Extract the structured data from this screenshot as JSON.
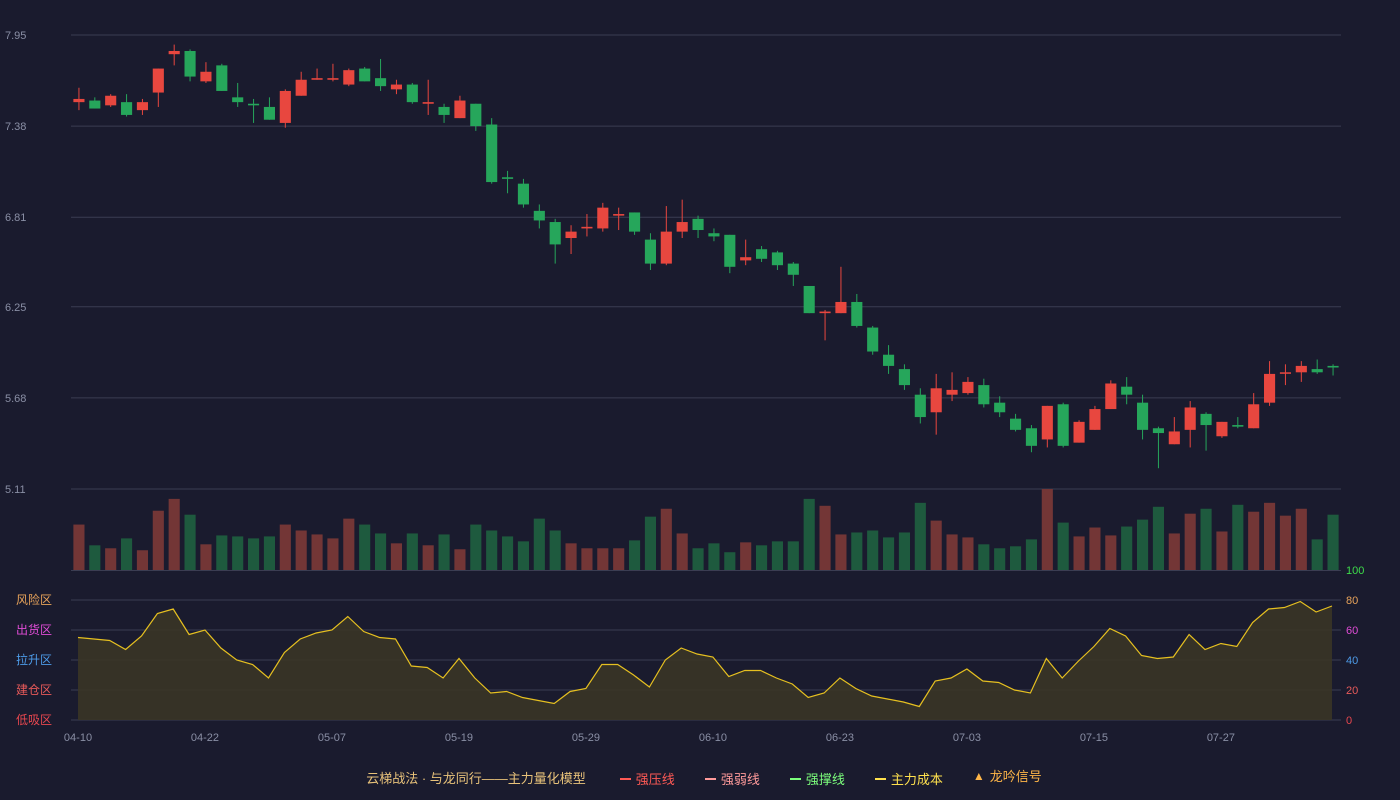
{
  "colors": {
    "up": "#e8473f",
    "down": "#26a65b",
    "vol_up": "#733636",
    "vol_down": "#1e5a3e",
    "grid": "#3b3d52",
    "axis_text": "#8a8fa5",
    "line": "#e6c020",
    "line_fill": "#3a3526"
  },
  "legend": {
    "title": "云梯战法 · 与龙同行——主力量化模型",
    "items": [
      {
        "label": "强压线",
        "color": "#ff5a55",
        "style": "solid",
        "icon": "solid-line-icon"
      },
      {
        "label": "强弱线",
        "color": "#ff9a9a",
        "style": "dashed",
        "icon": "dashed-line-icon"
      },
      {
        "label": "强撑线",
        "color": "#7cff7c",
        "style": "solid",
        "icon": "solid-line-icon"
      },
      {
        "label": "主力成本",
        "color": "#ffe14d",
        "style": "dashed",
        "icon": "dashed-line-icon"
      },
      {
        "label": "龙吟信号",
        "color": "#ffb648",
        "style": "triangle",
        "icon": "triangle-icon"
      }
    ]
  },
  "chart_data": [
    {
      "type": "candlestick",
      "y_ticks": [
        "7.95",
        "7.38",
        "6.81",
        "6.25",
        "5.68",
        "5.11"
      ],
      "ylim": [
        5.11,
        7.95
      ],
      "x_ticks": [
        {
          "i": 0,
          "label": "04-10"
        },
        {
          "i": 8,
          "label": "04-22"
        },
        {
          "i": 16,
          "label": "05-07"
        },
        {
          "i": 24,
          "label": "05-19"
        },
        {
          "i": 32,
          "label": "05-29"
        },
        {
          "i": 40,
          "label": "06-10"
        },
        {
          "i": 48,
          "label": "06-23"
        },
        {
          "i": 56,
          "label": "07-03"
        },
        {
          "i": 64,
          "label": "07-15"
        },
        {
          "i": 72,
          "label": "07-27"
        }
      ],
      "ohlc": [
        [
          7.53,
          7.55,
          7.48,
          7.62
        ],
        [
          7.54,
          7.49,
          7.49,
          7.56
        ],
        [
          7.51,
          7.57,
          7.5,
          7.58
        ],
        [
          7.53,
          7.45,
          7.44,
          7.58
        ],
        [
          7.48,
          7.53,
          7.45,
          7.55
        ],
        [
          7.59,
          7.74,
          7.5,
          7.74
        ],
        [
          7.83,
          7.85,
          7.76,
          7.89
        ],
        [
          7.85,
          7.69,
          7.66,
          7.86
        ],
        [
          7.66,
          7.72,
          7.65,
          7.78
        ],
        [
          7.76,
          7.6,
          7.6,
          7.77
        ],
        [
          7.56,
          7.53,
          7.5,
          7.65
        ],
        [
          7.52,
          7.51,
          7.4,
          7.55
        ],
        [
          7.5,
          7.42,
          7.42,
          7.56
        ],
        [
          7.4,
          7.6,
          7.37,
          7.61
        ],
        [
          7.57,
          7.67,
          7.57,
          7.72
        ],
        [
          7.67,
          7.68,
          7.67,
          7.74
        ],
        [
          7.67,
          7.68,
          7.66,
          7.77
        ],
        [
          7.64,
          7.73,
          7.63,
          7.74
        ],
        [
          7.74,
          7.66,
          7.66,
          7.75
        ],
        [
          7.68,
          7.63,
          7.6,
          7.8
        ],
        [
          7.61,
          7.64,
          7.58,
          7.67
        ],
        [
          7.64,
          7.53,
          7.52,
          7.65
        ],
        [
          7.52,
          7.53,
          7.45,
          7.67
        ],
        [
          7.5,
          7.45,
          7.4,
          7.52
        ],
        [
          7.43,
          7.54,
          7.43,
          7.57
        ],
        [
          7.52,
          7.38,
          7.35,
          7.52
        ],
        [
          7.39,
          7.03,
          7.02,
          7.43
        ],
        [
          7.06,
          7.05,
          6.96,
          7.1
        ],
        [
          7.02,
          6.89,
          6.87,
          7.05
        ],
        [
          6.85,
          6.79,
          6.74,
          6.89
        ],
        [
          6.78,
          6.64,
          6.52,
          6.8
        ],
        [
          6.68,
          6.72,
          6.58,
          6.76
        ],
        [
          6.74,
          6.75,
          6.69,
          6.83
        ],
        [
          6.74,
          6.87,
          6.72,
          6.9
        ],
        [
          6.82,
          6.83,
          6.73,
          6.87
        ],
        [
          6.84,
          6.72,
          6.7,
          6.84
        ],
        [
          6.67,
          6.52,
          6.48,
          6.71
        ],
        [
          6.52,
          6.72,
          6.51,
          6.88
        ],
        [
          6.72,
          6.78,
          6.68,
          6.92
        ],
        [
          6.8,
          6.73,
          6.68,
          6.82
        ],
        [
          6.71,
          6.69,
          6.66,
          6.74
        ],
        [
          6.7,
          6.5,
          6.46,
          6.7
        ],
        [
          6.54,
          6.56,
          6.51,
          6.67
        ],
        [
          6.61,
          6.55,
          6.53,
          6.63
        ],
        [
          6.59,
          6.51,
          6.48,
          6.6
        ],
        [
          6.52,
          6.45,
          6.38,
          6.53
        ],
        [
          6.38,
          6.21,
          6.21,
          6.38
        ],
        [
          6.21,
          6.22,
          6.04,
          6.23
        ],
        [
          6.21,
          6.28,
          6.21,
          6.5
        ],
        [
          6.28,
          6.13,
          6.12,
          6.33
        ],
        [
          6.12,
          5.97,
          5.95,
          6.13
        ],
        [
          5.95,
          5.88,
          5.83,
          6.01
        ],
        [
          5.86,
          5.76,
          5.73,
          5.89
        ],
        [
          5.7,
          5.56,
          5.52,
          5.74
        ],
        [
          5.59,
          5.74,
          5.45,
          5.83
        ],
        [
          5.7,
          5.73,
          5.66,
          5.84
        ],
        [
          5.71,
          5.78,
          5.7,
          5.81
        ],
        [
          5.76,
          5.64,
          5.62,
          5.8
        ],
        [
          5.65,
          5.59,
          5.56,
          5.69
        ],
        [
          5.55,
          5.48,
          5.47,
          5.58
        ],
        [
          5.49,
          5.38,
          5.34,
          5.51
        ],
        [
          5.42,
          5.63,
          5.37,
          5.63
        ],
        [
          5.64,
          5.38,
          5.37,
          5.65
        ],
        [
          5.4,
          5.53,
          5.4,
          5.54
        ],
        [
          5.48,
          5.61,
          5.48,
          5.63
        ],
        [
          5.61,
          5.77,
          5.61,
          5.79
        ],
        [
          5.75,
          5.7,
          5.64,
          5.81
        ],
        [
          5.65,
          5.48,
          5.42,
          5.7
        ],
        [
          5.49,
          5.46,
          5.24,
          5.5
        ],
        [
          5.39,
          5.47,
          5.39,
          5.56
        ],
        [
          5.48,
          5.62,
          5.37,
          5.66
        ],
        [
          5.58,
          5.51,
          5.35,
          5.59
        ],
        [
          5.44,
          5.53,
          5.43,
          5.53
        ],
        [
          5.51,
          5.5,
          5.49,
          5.56
        ],
        [
          5.49,
          5.64,
          5.49,
          5.71
        ],
        [
          5.65,
          5.83,
          5.63,
          5.91
        ],
        [
          5.84,
          5.84,
          5.76,
          5.89
        ],
        [
          5.84,
          5.88,
          5.78,
          5.91
        ],
        [
          5.86,
          5.84,
          5.83,
          5.92
        ],
        [
          5.88,
          5.87,
          5.82,
          5.89
        ]
      ]
    },
    {
      "type": "bar",
      "name": "volume",
      "values": [
        46,
        25,
        22,
        32,
        20,
        60,
        72,
        56,
        26,
        35,
        34,
        32,
        34,
        46,
        40,
        36,
        32,
        52,
        46,
        37,
        27,
        37,
        25,
        36,
        21,
        46,
        40,
        34,
        29,
        52,
        40,
        27,
        22,
        22,
        22,
        30,
        54,
        62,
        37,
        22,
        27,
        18,
        28,
        25,
        29,
        29,
        72,
        65,
        36,
        38,
        40,
        33,
        38,
        68,
        50,
        36,
        33,
        26,
        22,
        24,
        31,
        82,
        48,
        34,
        43,
        35,
        44,
        51,
        64,
        37,
        57,
        62,
        39,
        66,
        59,
        68,
        55,
        62,
        31,
        56
      ]
    },
    {
      "type": "area",
      "name": "indicator",
      "ylim": [
        0,
        100
      ],
      "y_ticks": [
        "100",
        "80",
        "60",
        "40",
        "20",
        "0"
      ],
      "zones": [
        "风险区",
        "出货区",
        "拉升区",
        "建仓区",
        "低吸区"
      ],
      "zone_colors": [
        "#e8a35a",
        "#e04cd6",
        "#4d9be8",
        "#e85a5a",
        "#e8474f"
      ],
      "tick_colors": [
        "#3ddc4a",
        "#e8a35a",
        "#e04cd6",
        "#4d9be8",
        "#e85a5a",
        "#e8474f"
      ],
      "values": [
        55,
        54,
        53,
        47,
        56,
        71,
        74,
        57,
        60,
        48,
        40,
        37,
        28,
        45,
        54,
        58,
        60,
        69,
        59,
        55,
        54,
        36,
        35,
        28,
        41,
        28,
        18,
        19,
        15,
        13,
        11,
        19,
        21,
        37,
        37,
        30,
        22,
        40,
        48,
        44,
        42,
        29,
        33,
        33,
        28,
        24,
        15,
        18,
        28,
        21,
        16,
        14,
        12,
        9,
        26,
        28,
        34,
        26,
        25,
        20,
        18,
        41,
        28,
        39,
        49,
        61,
        56,
        43,
        41,
        42,
        57,
        47,
        51,
        49,
        65,
        74,
        75,
        79,
        72,
        76
      ]
    }
  ]
}
